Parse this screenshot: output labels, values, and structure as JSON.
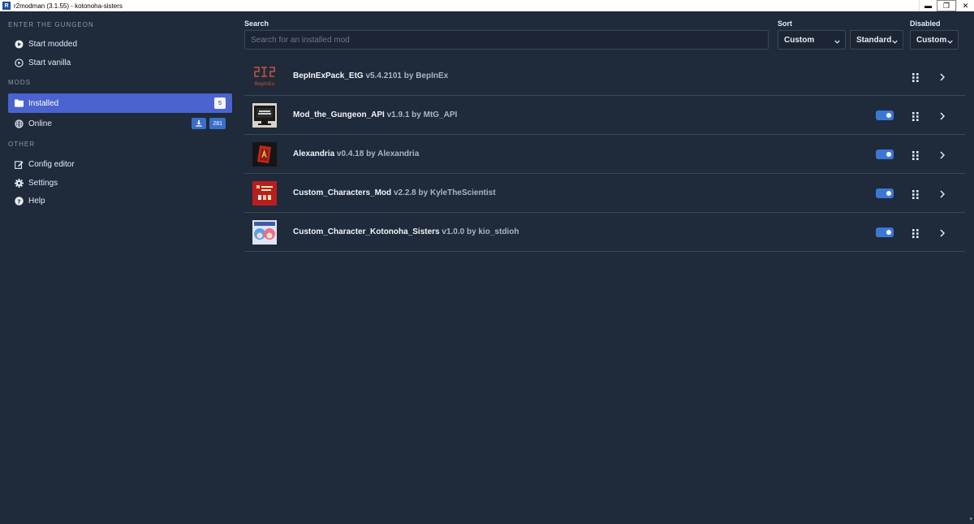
{
  "window": {
    "title": "r2modman (3.1.55) - kotonoha-sisters",
    "app_icon_letter": "R",
    "minimize": "▬",
    "restore": "❐",
    "close": "✕"
  },
  "sidebar": {
    "section_game": "ENTER THE GUNGEON",
    "start_modded": "Start modded",
    "start_vanilla": "Start vanilla",
    "section_mods": "MODS",
    "installed": "Installed",
    "installed_count": "5",
    "online": "Online",
    "online_count": "281",
    "section_other": "OTHER",
    "config_editor": "Config editor",
    "settings": "Settings",
    "help": "Help"
  },
  "toolbar": {
    "search_label": "Search",
    "search_placeholder": "Search for an installed mod",
    "search_value": "",
    "sort_label": "Sort",
    "sort_value": "Custom",
    "order_value": "Standard",
    "disabled_label": "Disabled",
    "disabled_value": "Custom"
  },
  "mods": [
    {
      "name": "BepInExPack_EtG",
      "meta": "v5.4.2101 by BepInEx",
      "has_toggle": false,
      "enabled": true
    },
    {
      "name": "Mod_the_Gungeon_API",
      "meta": "v1.9.1 by MtG_API",
      "has_toggle": true,
      "enabled": true
    },
    {
      "name": "Alexandria",
      "meta": "v0.4.18 by Alexandria",
      "has_toggle": true,
      "enabled": true
    },
    {
      "name": "Custom_Characters_Mod",
      "meta": "v2.2.8 by KyleTheScientist",
      "has_toggle": true,
      "enabled": true
    },
    {
      "name": "Custom_Character_Kotonoha_Sisters",
      "meta": "v1.0.0 by kio_stdioh",
      "has_toggle": true,
      "enabled": true
    }
  ],
  "thumb_text": {
    "bepinex": "BepInEx"
  },
  "colors": {
    "background": "#1f2a3a",
    "accent": "#4a63cf",
    "toggle_on": "#3a78d4"
  }
}
